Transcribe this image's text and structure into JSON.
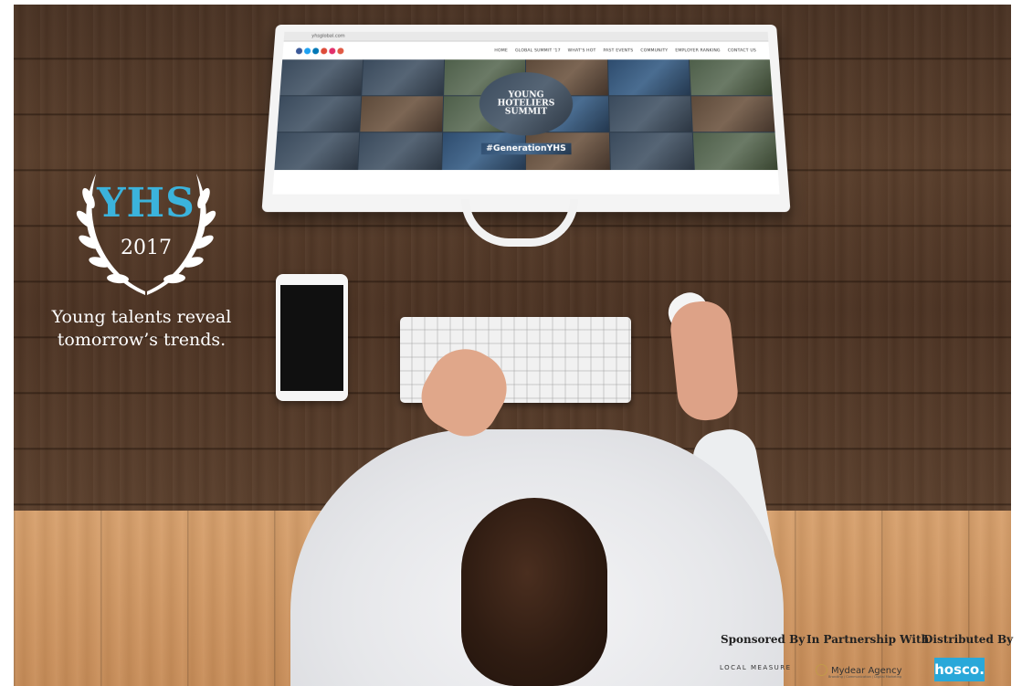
{
  "logo": {
    "title": "YHS",
    "year": "2017",
    "tagline_line1": "Young talents reveal",
    "tagline_line2": "tomorrow’s trends."
  },
  "monitor_screen": {
    "url": "yhsglobal.com",
    "nav_items": [
      "HOME",
      "GLOBAL SUMMIT '17",
      "WHAT'S HOT",
      "PAST EVENTS",
      "COMMUNITY",
      "EMPLOYER RANKING",
      "CONTACT US"
    ],
    "hero_line1": "YOUNG",
    "hero_line2": "HOTELIERS",
    "hero_line3": "SUMMIT",
    "hashtag": "#GenerationYHS"
  },
  "footer": {
    "sponsored_by": "Sponsored By",
    "in_partnership_with": "In Partnership With",
    "distributed_by": "Distributed By",
    "sponsor_logo_text": "LOCAL MEASURE",
    "partner_logo_text": "Mydear Agency",
    "partner_logo_subtext": "Branding / Communication / Digital Marketing",
    "distributor_logo_text": "hosco."
  },
  "colors": {
    "yhs_blue": "#3bb3dc",
    "hosco_blue": "#29a8d9",
    "desk_wood": "#4d3424",
    "floor_wood": "#d09a63"
  }
}
